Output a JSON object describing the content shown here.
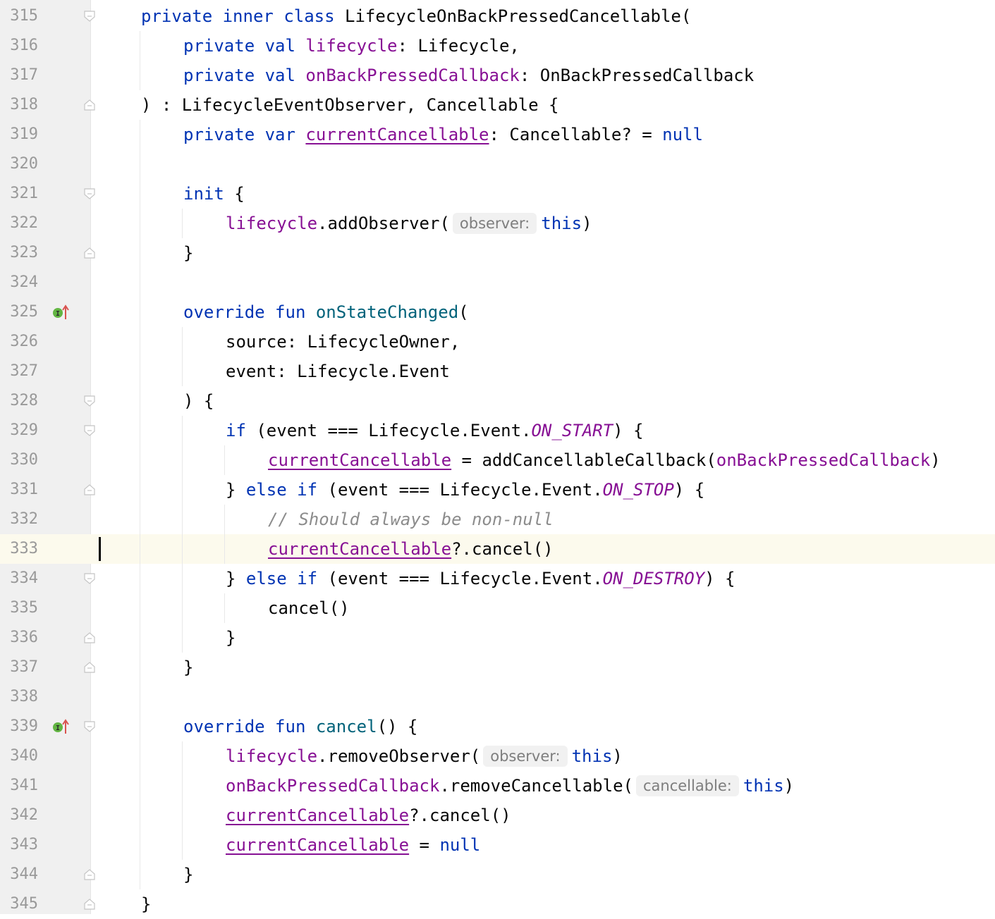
{
  "editor": {
    "colors": {
      "keyword": "#0033b3",
      "property": "#871094",
      "function": "#00627a",
      "comment": "#8c8c8c",
      "text": "#080808",
      "gutter": "#f0f0f0",
      "current_line": "#fcfaed"
    },
    "current_line_number": "333",
    "lines": [
      {
        "n": "315",
        "fold": "open",
        "icon": ""
      },
      {
        "n": "316",
        "fold": "",
        "icon": ""
      },
      {
        "n": "317",
        "fold": "",
        "icon": ""
      },
      {
        "n": "318",
        "fold": "close",
        "icon": ""
      },
      {
        "n": "319",
        "fold": "",
        "icon": ""
      },
      {
        "n": "320",
        "fold": "",
        "icon": ""
      },
      {
        "n": "321",
        "fold": "open",
        "icon": ""
      },
      {
        "n": "322",
        "fold": "",
        "icon": ""
      },
      {
        "n": "323",
        "fold": "close",
        "icon": ""
      },
      {
        "n": "324",
        "fold": "",
        "icon": ""
      },
      {
        "n": "325",
        "fold": "",
        "icon": "implements-icon"
      },
      {
        "n": "326",
        "fold": "",
        "icon": ""
      },
      {
        "n": "327",
        "fold": "",
        "icon": ""
      },
      {
        "n": "328",
        "fold": "open",
        "icon": ""
      },
      {
        "n": "329",
        "fold": "open",
        "icon": ""
      },
      {
        "n": "330",
        "fold": "",
        "icon": ""
      },
      {
        "n": "331",
        "fold": "close",
        "icon": ""
      },
      {
        "n": "332",
        "fold": "",
        "icon": ""
      },
      {
        "n": "333",
        "fold": "",
        "icon": ""
      },
      {
        "n": "334",
        "fold": "open",
        "icon": ""
      },
      {
        "n": "335",
        "fold": "",
        "icon": ""
      },
      {
        "n": "336",
        "fold": "close",
        "icon": ""
      },
      {
        "n": "337",
        "fold": "close",
        "icon": ""
      },
      {
        "n": "338",
        "fold": "",
        "icon": ""
      },
      {
        "n": "339",
        "fold": "open",
        "icon": "implements-icon"
      },
      {
        "n": "340",
        "fold": "",
        "icon": ""
      },
      {
        "n": "341",
        "fold": "",
        "icon": ""
      },
      {
        "n": "342",
        "fold": "",
        "icon": ""
      },
      {
        "n": "343",
        "fold": "",
        "icon": ""
      },
      {
        "n": "344",
        "fold": "close",
        "icon": ""
      },
      {
        "n": "345",
        "fold": "close",
        "icon": ""
      }
    ],
    "code": {
      "l315": {
        "t1": "private",
        "t2": "inner",
        "t3": "class",
        "t4": "LifecycleOnBackPressedCancellable("
      },
      "l316": {
        "t1": "private",
        "t2": "val",
        "t3": "lifecycle",
        "t4": ": Lifecycle,"
      },
      "l317": {
        "t1": "private",
        "t2": "val",
        "t3": "onBackPressedCallback",
        "t4": ": OnBackPressedCallback"
      },
      "l318": {
        "t1": ") : LifecycleEventObserver, Cancellable {"
      },
      "l319": {
        "t1": "private",
        "t2": "var",
        "t3": "currentCancellable",
        "t4": ": Cancellable? = ",
        "t5": "null"
      },
      "l321": {
        "t1": "init",
        "t2": " {"
      },
      "l322": {
        "t1": "lifecycle",
        "t2": ".addObserver(",
        "hint": "observer:",
        "t3": "this",
        "t4": ")"
      },
      "l323": {
        "t1": "}"
      },
      "l325": {
        "t1": "override",
        "t2": "fun",
        "t3": "onStateChanged",
        "t4": "("
      },
      "l326": {
        "t1": "source: LifecycleOwner,"
      },
      "l327": {
        "t1": "event: Lifecycle.Event"
      },
      "l328": {
        "t1": ") {"
      },
      "l329": {
        "t1": "if",
        "t2": " (event === Lifecycle.Event.",
        "t3": "ON_START",
        "t4": ") {"
      },
      "l330": {
        "t1": "currentCancellable",
        "t2": " = addCancellableCallback(",
        "t3": "onBackPressedCallback",
        "t4": ")"
      },
      "l331": {
        "t1": "} ",
        "t2": "else if",
        "t3": " (event === Lifecycle.Event.",
        "t4": "ON_STOP",
        "t5": ") {"
      },
      "l332": {
        "t1": "// Should always be non-null"
      },
      "l333": {
        "t1": "currentCancellable",
        "t2": "?.cancel()"
      },
      "l334": {
        "t1": "} ",
        "t2": "else if",
        "t3": " (event === Lifecycle.Event.",
        "t4": "ON_DESTROY",
        "t5": ") {"
      },
      "l335": {
        "t1": "cancel()"
      },
      "l336": {
        "t1": "}"
      },
      "l337": {
        "t1": "}"
      },
      "l339": {
        "t1": "override",
        "t2": "fun",
        "t3": "cancel",
        "t4": "() {"
      },
      "l340": {
        "t1": "lifecycle",
        "t2": ".removeObserver(",
        "hint": "observer:",
        "t3": "this",
        "t4": ")"
      },
      "l341": {
        "t1": "onBackPressedCallback",
        "t2": ".removeCancellable(",
        "hint": "cancellable:",
        "t3": "this",
        "t4": ")"
      },
      "l342": {
        "t1": "currentCancellable",
        "t2": "?.cancel()"
      },
      "l343": {
        "t1": "currentCancellable",
        "t2": " = ",
        "t3": "null"
      },
      "l344": {
        "t1": "}"
      },
      "l345": {
        "t1": "}"
      }
    }
  }
}
